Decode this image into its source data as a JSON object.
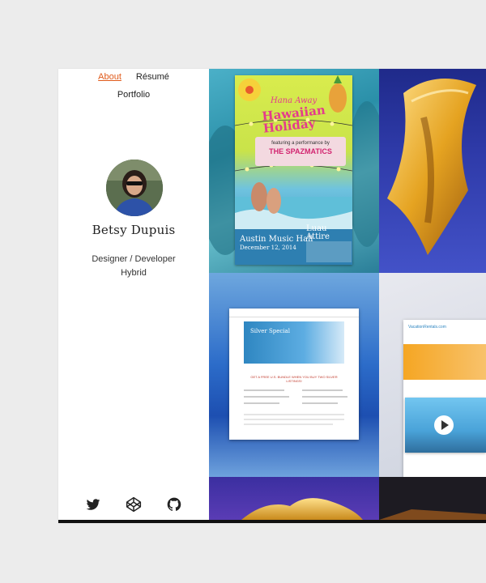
{
  "nav": {
    "about": "About",
    "resume": "Résumé",
    "portfolio": "Portfolio"
  },
  "profile": {
    "name": "Betsy Dupuis",
    "role_line1": "Designer / Developer",
    "role_line2": "Hybrid"
  },
  "socials": [
    "twitter-icon",
    "codepen-icon",
    "github-icon"
  ],
  "colors": {
    "accent": "#e05a1a",
    "background": "#ececec",
    "text": "#222222"
  },
  "portfolio": {
    "poster": {
      "title1": "Hana Away",
      "title2": "Hawaiian Holiday",
      "band": "THE SPAZMATICS",
      "venue": "Austin Music Hall",
      "date": "December 12, 2014",
      "luau": "Luau Attire"
    },
    "mock1": {
      "hero_text": "Silver Special",
      "headline": "GET A FREE U.S. BUNDLE WHEN YOU BUY TWO SILVER LISTINGS!"
    },
    "mock2": {
      "brand": "VacationRentals.com"
    }
  }
}
